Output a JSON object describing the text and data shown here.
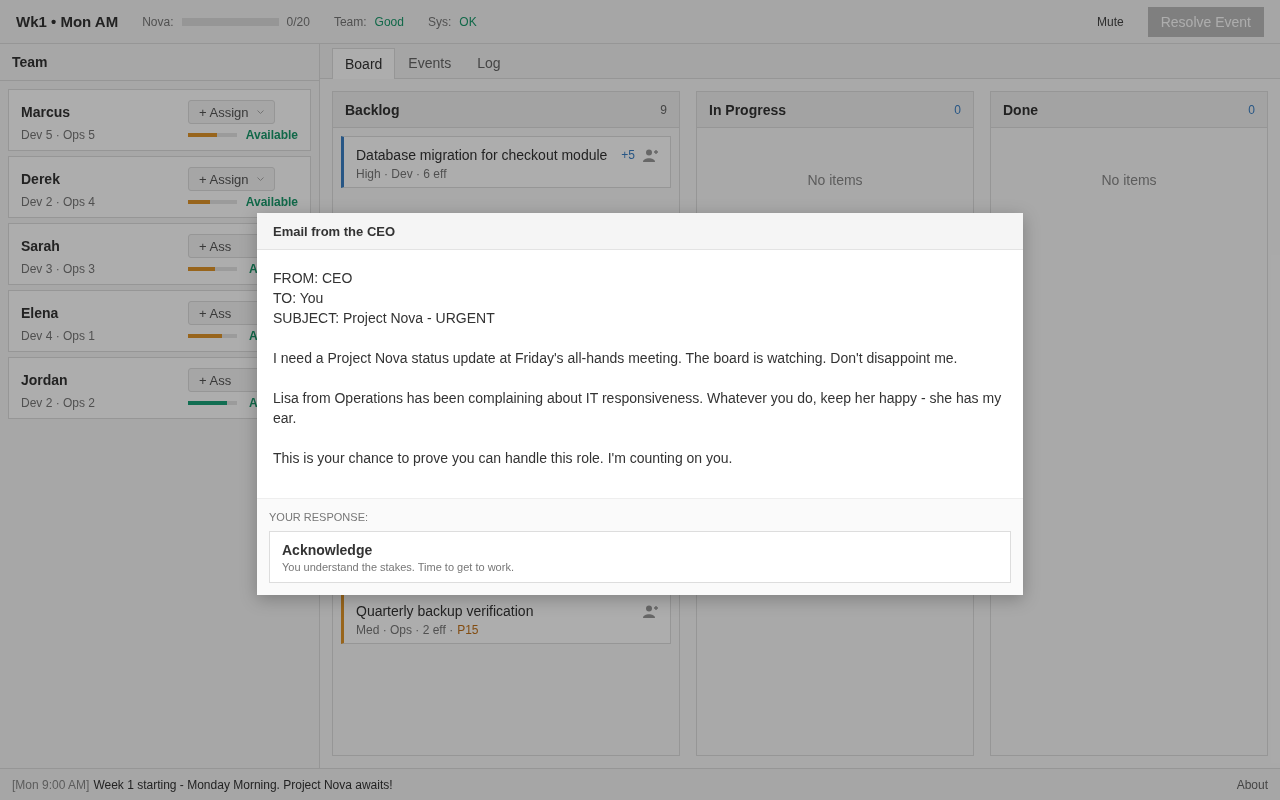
{
  "header": {
    "title": "Wk1 • Mon AM",
    "nova": {
      "label": "Nova:",
      "level": 0,
      "reading": "0/20"
    },
    "team": {
      "label": "Team:",
      "value": "Good"
    },
    "sys": {
      "label": "Sys:",
      "value": "OK"
    },
    "mute": "Mute",
    "resolve": {
      "label": "Resolve Event",
      "disabled": true
    }
  },
  "sidebar": {
    "title": "Team",
    "members": [
      {
        "name": "Marcus",
        "skills": "Dev 5 · Ops 5",
        "assign": "+ Assign",
        "caret": true,
        "level": 0.6,
        "kind": "partial",
        "status": "Available"
      },
      {
        "name": "Derek",
        "skills": "Dev 2 · Ops 4",
        "assign": "+ Assign",
        "caret": true,
        "level": 0.45,
        "kind": "partial",
        "status": "Available"
      },
      {
        "name": "Sarah",
        "skills": "Dev 3 · Ops 3",
        "assign": "+ Ass",
        "caret": false,
        "level": 0.55,
        "kind": "partial",
        "status": "A"
      },
      {
        "name": "Elena",
        "skills": "Dev 4 · Ops 1",
        "assign": "+ Ass",
        "caret": false,
        "level": 0.7,
        "kind": "partial",
        "status": "A"
      },
      {
        "name": "Jordan",
        "skills": "Dev 2 · Ops 2",
        "assign": "+ Ass",
        "caret": false,
        "level": 0.8,
        "kind": "full",
        "status": "A"
      }
    ]
  },
  "tabs": [
    {
      "label": "Board",
      "selected": true
    },
    {
      "label": "Events",
      "selected": false
    },
    {
      "label": "Log",
      "selected": false
    }
  ],
  "columns": [
    {
      "title": "Backlog",
      "count": "9",
      "cards": [
        {
          "title": "Database migration for checkout module",
          "badge": "+5",
          "meta": "High · Dev · 6 eff",
          "kind": "high"
        },
        {
          "kind": "hidden"
        },
        {
          "title": "Quarterly backup verification",
          "meta": "Med · Ops · 2 eff ·",
          "tag": "P15",
          "kind": "med"
        }
      ]
    },
    {
      "title": "In Progress",
      "count": "0",
      "empty": "No items"
    },
    {
      "title": "Done",
      "count": "0",
      "empty": "No items"
    }
  ],
  "modal": {
    "title": "Email from the CEO",
    "paragraphs": [
      [
        "FROM: CEO",
        "TO: You",
        "SUBJECT: Project Nova - URGENT"
      ],
      [
        "I need a Project Nova status update at Friday's all-hands meeting. The board is watching. Don't disappoint me."
      ],
      [
        "Lisa from Operations has been complaining about IT responsiveness. Whatever you do, keep her happy - she has my ear."
      ],
      [
        "This is your chance to prove you can handle this role. I'm counting on you."
      ]
    ],
    "response_label": "YOUR RESPONSE:",
    "options": [
      {
        "title": "Acknowledge",
        "description": "You understand the stakes. Time to get to work."
      }
    ]
  },
  "status_bar": {
    "time": "[Mon 9:00 AM]",
    "message": "Week 1 starting - Monday Morning. Project Nova awaits!",
    "about": "About"
  }
}
